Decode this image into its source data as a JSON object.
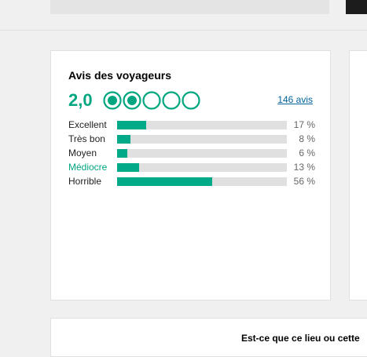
{
  "colors": {
    "brand_green": "#00a680",
    "bar_fill": "#00aa88",
    "bar_track": "#e0e0e0",
    "link": "#00629b"
  },
  "reviews": {
    "title": "Avis des voyageurs",
    "score": "2,0",
    "rating_value": 2,
    "rating_max": 5,
    "bubble_icon": "rating-bubble-icon",
    "count_link": "146 avis",
    "rows": [
      {
        "label": "Excellent",
        "pct": "17 %",
        "value": 17
      },
      {
        "label": "Très bon",
        "pct": "8 %",
        "value": 8
      },
      {
        "label": "Moyen",
        "pct": "6 %",
        "value": 6
      },
      {
        "label": "Médiocre",
        "pct": "13 %",
        "value": 13
      },
      {
        "label": "Horrible",
        "pct": "56 %",
        "value": 56
      }
    ]
  },
  "bottom": {
    "question_text": "Est-ce que ce lieu ou cette"
  }
}
